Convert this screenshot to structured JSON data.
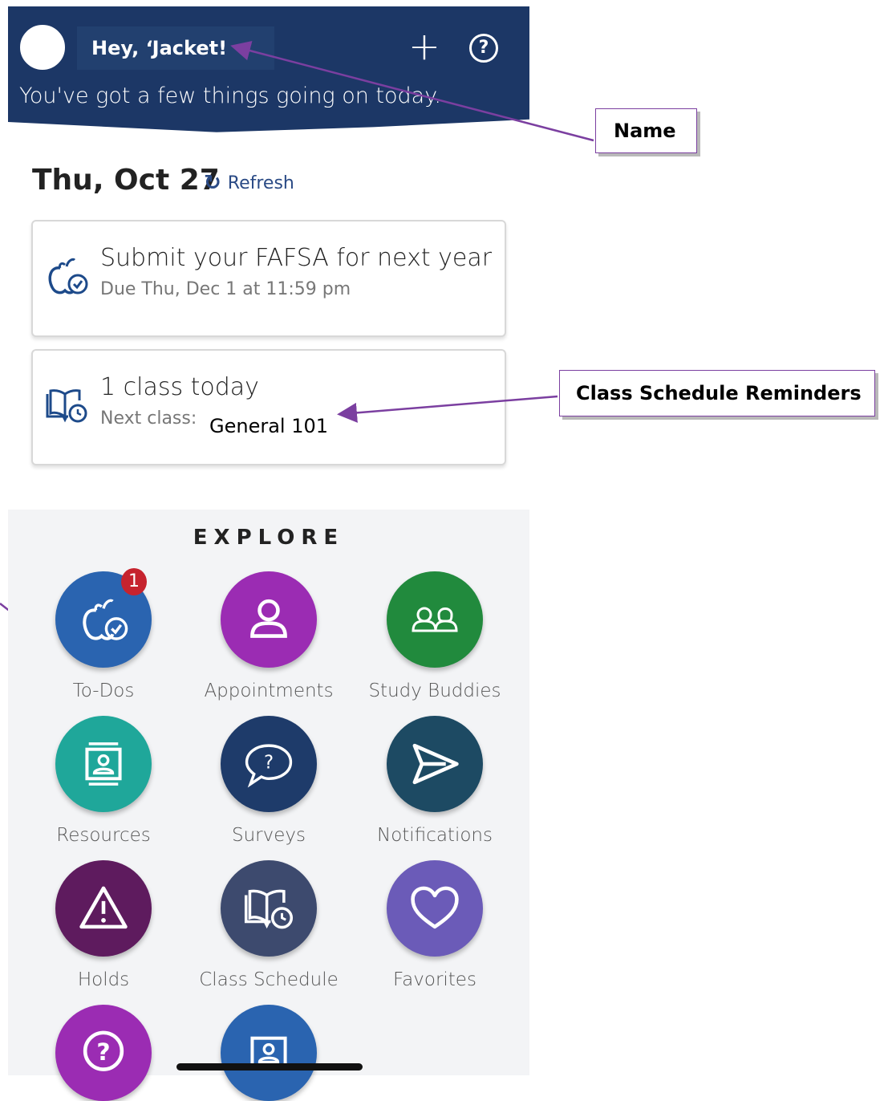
{
  "header": {
    "greeting": "Hey, ‘Jacket!",
    "subtext": "You've got a few things going on today.",
    "plus_glyph": "+",
    "help_glyph": "?"
  },
  "today": {
    "date": "Thu, Oct 27",
    "refresh_label": "Refresh"
  },
  "cards": [
    {
      "title": "Submit your FAFSA for next year",
      "subtitle": "Due Thu, Dec 1 at 11:59 pm"
    },
    {
      "title": "1 class today",
      "subtitle": "Next class:",
      "value": "General 101"
    }
  ],
  "annotations": {
    "name": "Name",
    "class_schedule": "Class Schedule Reminders"
  },
  "explore": {
    "title": "EXPLORE",
    "tiles": [
      {
        "label": "To-Dos",
        "badge": "1",
        "color": "#2a64b0",
        "icon": "apple-check-icon"
      },
      {
        "label": "Appointments",
        "color": "#9b2cb3",
        "icon": "person-icon"
      },
      {
        "label": "Study Buddies",
        "color": "#218a3d",
        "icon": "people-icon"
      },
      {
        "label": "Resources",
        "color": "#1fa79a",
        "icon": "contact-card-icon"
      },
      {
        "label": "Surveys",
        "color": "#1e3b6a",
        "icon": "speech-question-icon"
      },
      {
        "label": "Notifications",
        "color": "#1d4a63",
        "icon": "send-icon"
      },
      {
        "label": "Holds",
        "color": "#5e1b5e",
        "icon": "warning-icon"
      },
      {
        "label": "Class Schedule",
        "color": "#3d4a6e",
        "icon": "book-watch-icon"
      },
      {
        "label": "Favorites",
        "color": "#6b5bb8",
        "icon": "heart-icon"
      },
      {
        "label": "",
        "color": "#9b2cb3",
        "icon": "question-icon"
      },
      {
        "label": "",
        "color": "#2a64b0",
        "icon": "contact-card-icon"
      }
    ]
  }
}
